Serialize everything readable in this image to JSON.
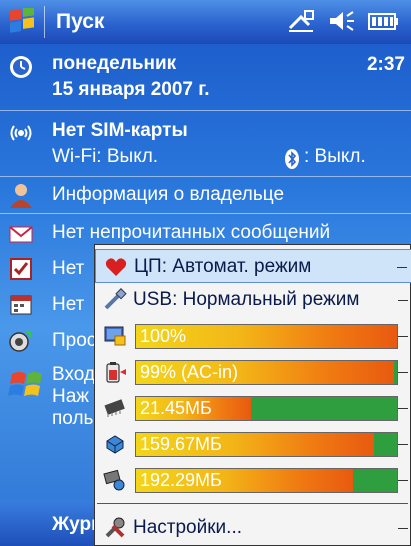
{
  "titlebar": {
    "title": "Пуск",
    "clock": "2:37"
  },
  "today": {
    "date_day": "понедельник",
    "date_full": "15 января 2007 г.",
    "sim_title": "Нет SIM-карты",
    "wifi_label": "Wi-Fi: Выкл.",
    "bt_label": ": Выкл.",
    "owner_info": "Информация о владельце",
    "messages": "Нет непрочитанных сообщений",
    "row5_partial": "Нет",
    "row6_partial": "Нет",
    "row7_partial": "Прос",
    "login_line1": "Вход",
    "login_line2": "Наж",
    "login_line3": "польз"
  },
  "bottom": {
    "left_label": "Журн"
  },
  "popup": {
    "items": [
      {
        "label": "ЦП: Автомат. режим",
        "icon": "heart-icon"
      },
      {
        "label": "USB: Нормальный режим",
        "icon": "usb-icon"
      }
    ],
    "bars": [
      {
        "label": "100%",
        "icon": "display-battery-icon",
        "fill": 1.0
      },
      {
        "label": "99% (AC-in)",
        "icon": "battery-icon",
        "fill": 0.99
      },
      {
        "label": "21.45МБ",
        "icon": "memory-chip-icon",
        "fill": 0.44
      },
      {
        "label": "159.67МБ",
        "icon": "storage-icon",
        "fill": 0.91
      },
      {
        "label": "192.29МБ",
        "icon": "card-storage-icon",
        "fill": 0.83
      }
    ],
    "settings_label": "Настройки..."
  },
  "colors": {
    "titlebar": "#2b63cf",
    "popup_bg": "#f4f4f4",
    "bar_green": "#2e9e3e",
    "bar_orange": "#f07a12"
  }
}
